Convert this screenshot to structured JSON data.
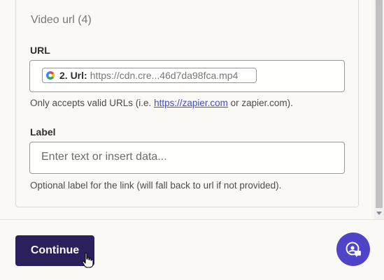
{
  "video_url_section": {
    "legend": "Video url (4)",
    "url_field": {
      "label": "URL",
      "pill_step": "2. Url:",
      "pill_value": "https://cdn.cre...46d7da98fca.mp4",
      "help_prefix": "Only accepts valid URLs (i.e. ",
      "help_link": "https://zapier.com",
      "help_suffix": " or zapier.com)."
    },
    "label_field": {
      "label": "Label",
      "placeholder": "Enter text or insert data...",
      "help": "Optional label for the link (will fall back to url if not provided)."
    }
  },
  "footer": {
    "continue_label": "Continue"
  },
  "icons": {
    "pill_app": "app-logo-icon",
    "cursor": "hand-pointer-icon",
    "help_fab": "support-chat-icon"
  },
  "colors": {
    "primary_button": "#2b1f5c",
    "fab": "#4f44c7",
    "link": "#3d4ad9"
  }
}
